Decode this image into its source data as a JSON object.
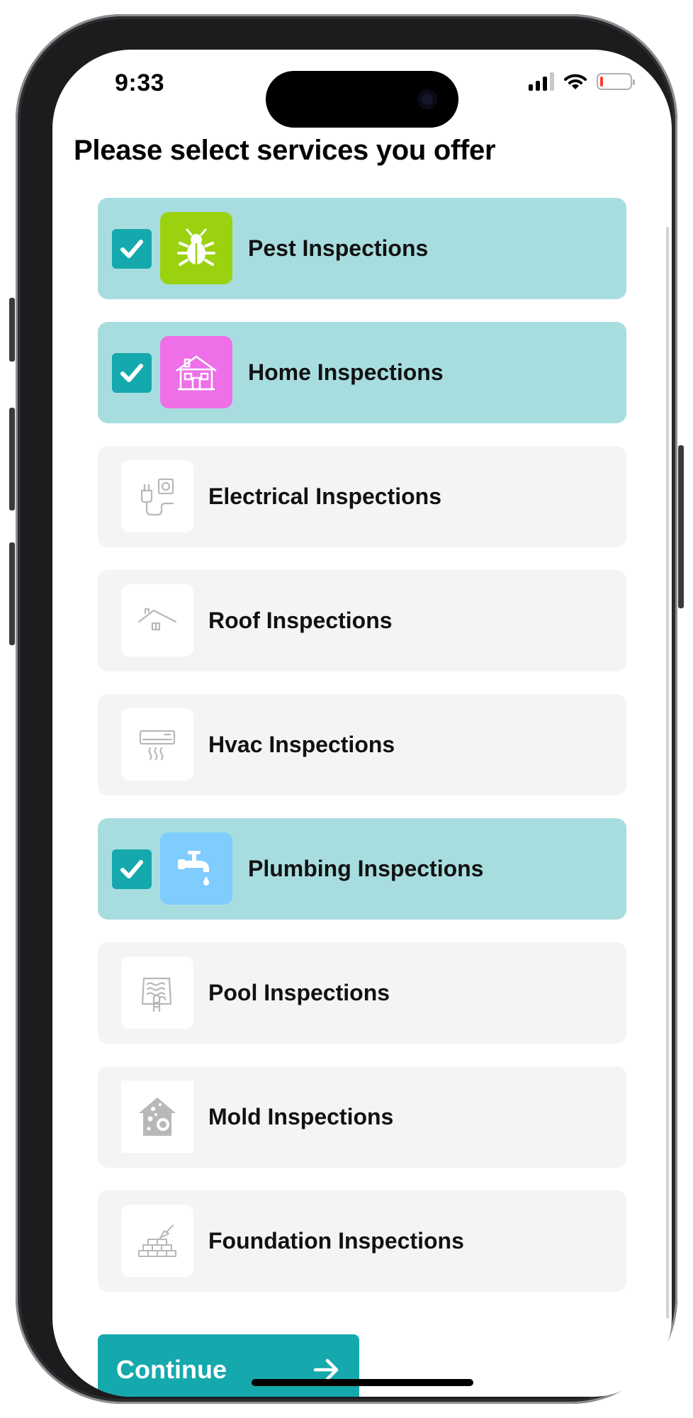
{
  "status_bar": {
    "time": "9:33",
    "battery_color": "#ff3b30"
  },
  "page": {
    "title": "Please select services you offer"
  },
  "accent_color": "#15a9ad",
  "selected_card_color": "#a8dde0",
  "services": [
    {
      "label": "Pest Inspections",
      "selected": true,
      "icon": "bug-icon",
      "tile_color": "#9bd10f"
    },
    {
      "label": "Home Inspections",
      "selected": true,
      "icon": "house-icon",
      "tile_color": "#ee6fe8"
    },
    {
      "label": "Electrical Inspections",
      "selected": false,
      "icon": "plug-icon",
      "tile_color": "#ffffff"
    },
    {
      "label": "Roof Inspections",
      "selected": false,
      "icon": "roof-icon",
      "tile_color": "#ffffff"
    },
    {
      "label": "Hvac Inspections",
      "selected": false,
      "icon": "air-conditioner-icon",
      "tile_color": "#ffffff"
    },
    {
      "label": "Plumbing Inspections",
      "selected": true,
      "icon": "faucet-icon",
      "tile_color": "#7fccff"
    },
    {
      "label": "Pool Inspections",
      "selected": false,
      "icon": "pool-icon",
      "tile_color": "#ffffff"
    },
    {
      "label": "Mold Inspections",
      "selected": false,
      "icon": "mold-house-icon",
      "tile_color": "#ffffff"
    },
    {
      "label": "Foundation Inspections",
      "selected": false,
      "icon": "bricks-trowel-icon",
      "tile_color": "#ffffff"
    }
  ],
  "continue_button": {
    "label": "Continue",
    "icon": "arrow-right-icon"
  }
}
